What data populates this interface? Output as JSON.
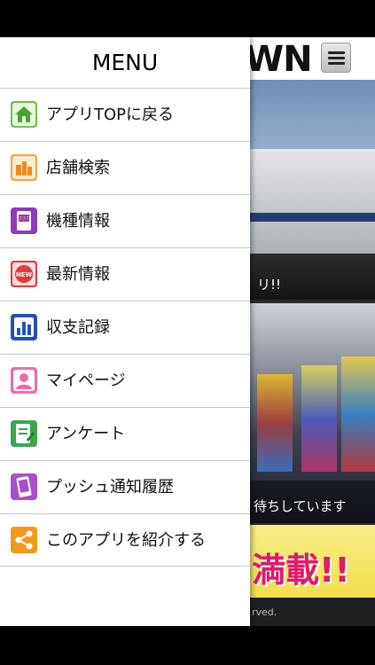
{
  "drawer": {
    "title": "MENU",
    "items": [
      {
        "label": "アプリTOPに戻る",
        "icon": "home-icon",
        "color": "#6cc04a"
      },
      {
        "label": "店舗検索",
        "icon": "store-search-icon",
        "color": "#f4a340"
      },
      {
        "label": "機種情報",
        "icon": "slot-machine-icon",
        "color": "#8e3bbf"
      },
      {
        "label": "最新情報",
        "icon": "new-badge-icon",
        "color": "#e23a3a"
      },
      {
        "label": "収支記録",
        "icon": "bar-chart-icon",
        "color": "#2452b3"
      },
      {
        "label": "マイページ",
        "icon": "user-icon",
        "color": "#f06aa8"
      },
      {
        "label": "アンケート",
        "icon": "survey-icon",
        "color": "#3aa64a"
      },
      {
        "label": "プッシュ通知履歴",
        "icon": "push-history-icon",
        "color": "#a84fc9"
      },
      {
        "label": "このアプリを紹介する",
        "icon": "share-icon",
        "color": "#f39a1c"
      }
    ]
  },
  "background": {
    "logo": "WN",
    "caption1": "リ!!",
    "caption2": "待ちしています",
    "banner": "満載!!",
    "footer": "rved."
  }
}
